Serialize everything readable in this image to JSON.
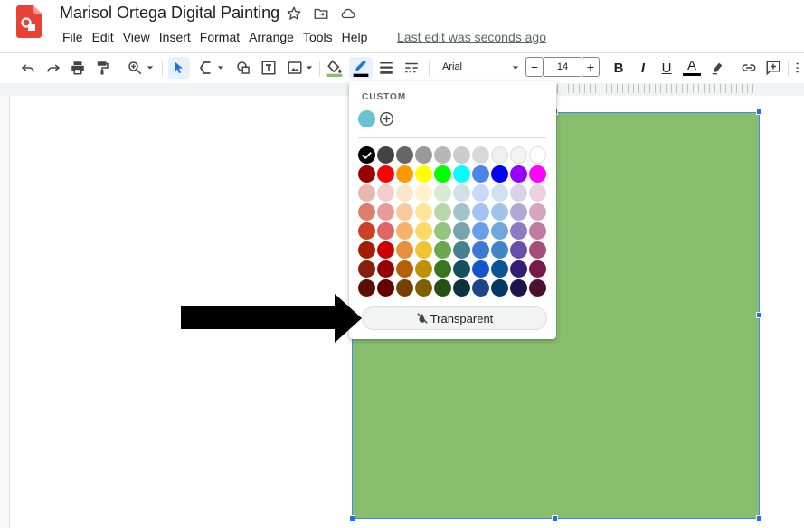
{
  "app": {
    "title": "Marisol Ortega Digital Painting",
    "last_edit": "Last edit was seconds ago"
  },
  "menu": [
    "File",
    "Edit",
    "View",
    "Insert",
    "Format",
    "Arrange",
    "Tools",
    "Help"
  ],
  "toolbar": {
    "font": "Arial",
    "font_size": "14",
    "decrease_label": "−",
    "increase_label": "+",
    "bold": "B",
    "italic": "I",
    "underline": "U",
    "text_color": "A"
  },
  "popup": {
    "custom_label": "CUSTOM",
    "custom_color": "#67c2d4",
    "transparent_label": "Transparent",
    "palette": [
      [
        "#000000",
        "#434343",
        "#666666",
        "#999999",
        "#b7b7b7",
        "#cccccc",
        "#d9d9d9",
        "#efefef",
        "#f3f3f3",
        "#ffffff"
      ],
      [
        "#980000",
        "#ff0000",
        "#ff9900",
        "#ffff00",
        "#00ff00",
        "#00ffff",
        "#4a86e8",
        "#0000ff",
        "#9900ff",
        "#ff00ff"
      ],
      [
        "#e6b8af",
        "#f4cccc",
        "#fce5cd",
        "#fff2cc",
        "#d9ead3",
        "#d0e0e3",
        "#c9daf8",
        "#cfe2f3",
        "#d9d2e9",
        "#ead1dc"
      ],
      [
        "#dd7e6b",
        "#ea9999",
        "#f9cb9c",
        "#ffe599",
        "#b6d7a8",
        "#a2c4c9",
        "#a4c2f4",
        "#9fc5e8",
        "#b4a7d6",
        "#d5a6bd"
      ],
      [
        "#cc4125",
        "#e06666",
        "#f6b26b",
        "#ffd966",
        "#93c47d",
        "#76a5af",
        "#6d9eeb",
        "#6fa8dc",
        "#8e7cc3",
        "#c27ba0"
      ],
      [
        "#a61c00",
        "#cc0000",
        "#e69138",
        "#f1c232",
        "#6aa84f",
        "#45818e",
        "#3c78d8",
        "#3d85c6",
        "#674ea7",
        "#a64d79"
      ],
      [
        "#85200c",
        "#990000",
        "#b45f06",
        "#bf9000",
        "#38761d",
        "#134f5c",
        "#1155cc",
        "#0b5394",
        "#351c75",
        "#741b47"
      ],
      [
        "#5b0f00",
        "#660000",
        "#783f04",
        "#7f6000",
        "#274e13",
        "#0c343d",
        "#1c4587",
        "#073763",
        "#20124d",
        "#4c1130"
      ]
    ],
    "selected": "#000000"
  },
  "colors": {
    "shape_fill": "#88bd6e",
    "selection": "#1a73e8",
    "fill_underline": "#88bd6e",
    "border_underline": "#000000"
  }
}
